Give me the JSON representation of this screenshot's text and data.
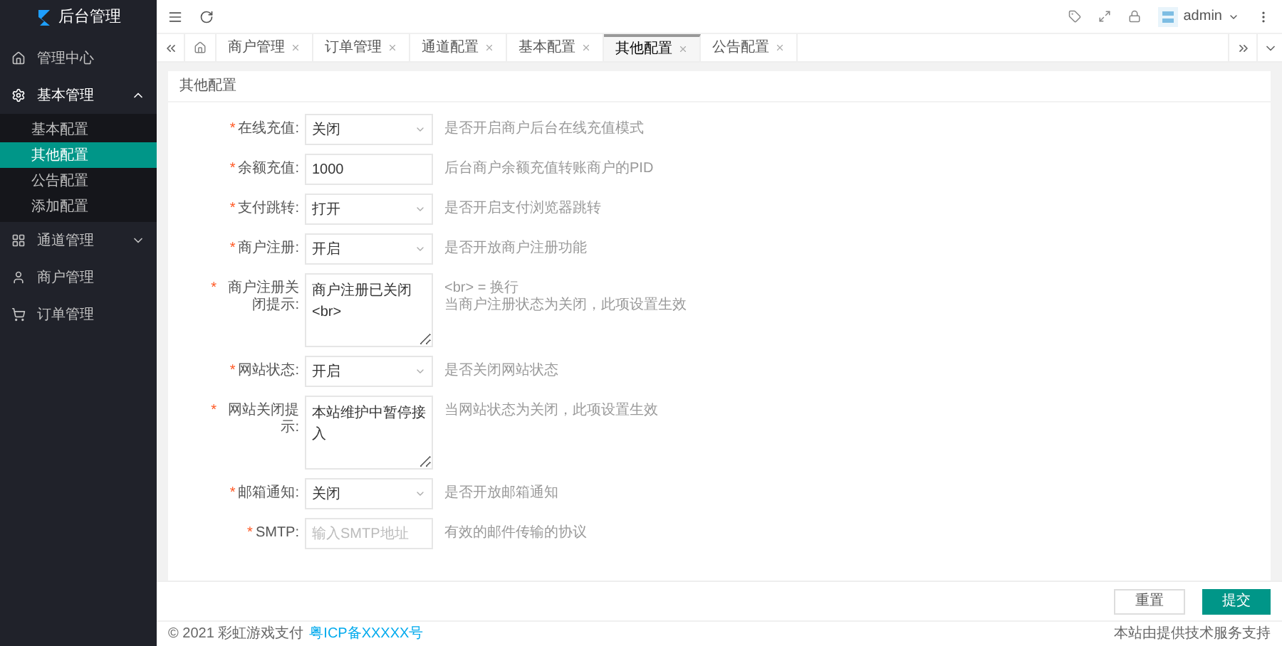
{
  "sidebar": {
    "logo": "后台管理",
    "items": [
      {
        "label": "管理中心",
        "expanded": false
      },
      {
        "label": "基本管理",
        "expanded": true,
        "children": [
          {
            "label": "基本配置",
            "selected": false
          },
          {
            "label": "其他配置",
            "selected": true
          },
          {
            "label": "公告配置",
            "selected": false
          },
          {
            "label": "添加配置",
            "selected": false
          }
        ]
      },
      {
        "label": "通道管理",
        "expanded": false,
        "collapsible": true
      },
      {
        "label": "商户管理",
        "expanded": false
      },
      {
        "label": "订单管理",
        "expanded": false
      }
    ]
  },
  "header": {
    "user": "admin"
  },
  "tabs": [
    {
      "label": "商户管理",
      "selected": false
    },
    {
      "label": "订单管理",
      "selected": false
    },
    {
      "label": "通道配置",
      "selected": false
    },
    {
      "label": "基本配置",
      "selected": false
    },
    {
      "label": "其他配置",
      "selected": true
    },
    {
      "label": "公告配置",
      "selected": false
    }
  ],
  "card": {
    "title": "其他配置",
    "fields": [
      {
        "kind": "select",
        "mark": "*",
        "label": "在线充值:",
        "value": "关闭",
        "hint": [
          "是否开启商户后台在线充值模式"
        ]
      },
      {
        "kind": "input",
        "mark": "*",
        "label": "余额充值:",
        "value": "1000",
        "hint": [
          "后台商户余额充值转账商户的PID"
        ]
      },
      {
        "kind": "select",
        "mark": "*",
        "label": "支付跳转:",
        "value": "打开",
        "hint": [
          "是否开启支付浏览器跳转"
        ]
      },
      {
        "kind": "select",
        "mark": "*",
        "label": "商户注册:",
        "value": "开启",
        "hint": [
          "是否开放商户注册功能"
        ]
      },
      {
        "kind": "textarea",
        "mark": "*",
        "label": "商户注册关闭提示:",
        "value": "商户注册已关闭<br>",
        "hint": [
          "<br> = 换行",
          "当商户注册状态为关闭，此项设置生效"
        ]
      },
      {
        "kind": "select",
        "mark": "*",
        "label": "网站状态:",
        "value": "开启",
        "hint": [
          "是否关闭网站状态"
        ]
      },
      {
        "kind": "textarea",
        "mark": "*",
        "label": "网站关闭提示:",
        "value": "本站维护中暂停接入",
        "hint": [
          "当网站状态为关闭，此项设置生效"
        ]
      },
      {
        "kind": "select",
        "mark": "*",
        "label": "邮箱通知:",
        "value": "关闭",
        "hint": [
          "是否开放邮箱通知"
        ]
      },
      {
        "kind": "input",
        "mark": "*",
        "label": "SMTP:",
        "placeholder": "输入SMTP地址",
        "hint": [
          "有效的邮件传输的协议"
        ]
      }
    ]
  },
  "actions": {
    "reset": "重置",
    "submit": "提交"
  },
  "footer": {
    "copyright": "© 2021 彩虹游戏支付",
    "icp": "粤ICP备XXXXX号",
    "support": "本站由提供技术服务支持"
  }
}
